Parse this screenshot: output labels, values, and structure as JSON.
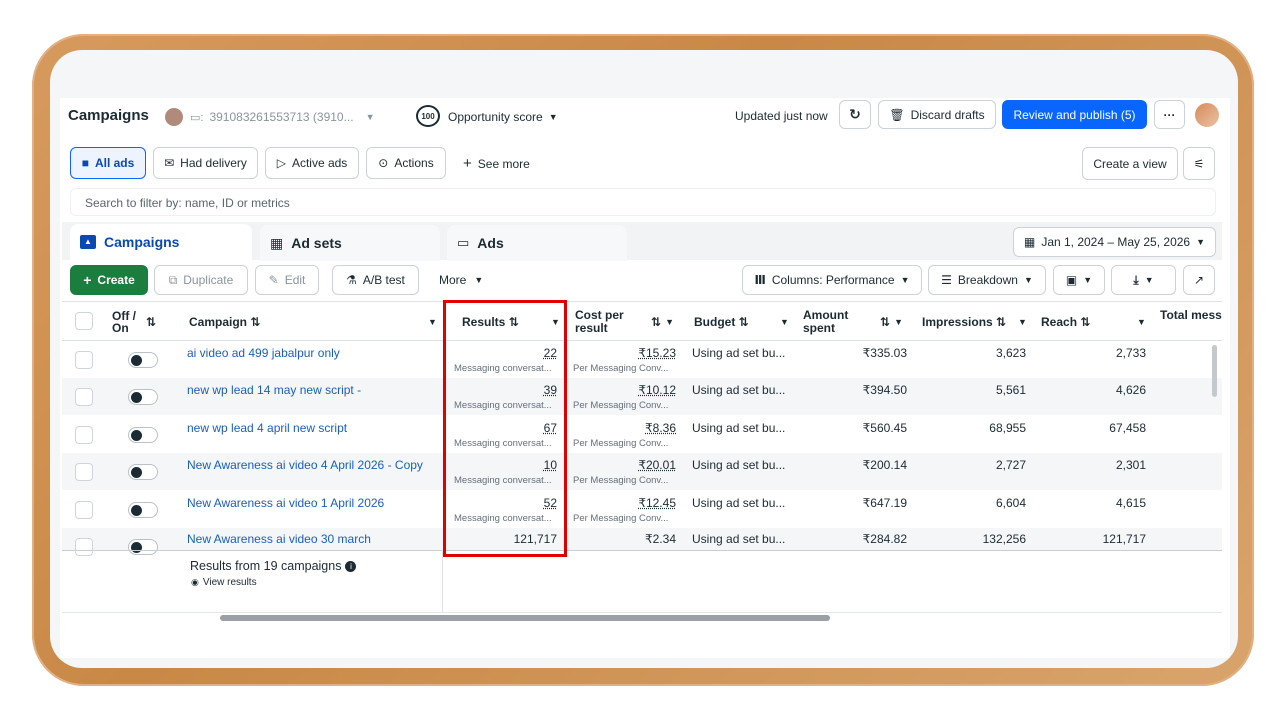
{
  "header": {
    "title": "Campaigns",
    "account_id": "391083261553713 (3910...",
    "opportunity_score_value": "100",
    "opportunity_label": "Opportunity score",
    "updated_text": "Updated just now",
    "discard_label": "Discard drafts",
    "review_label": "Review and publish (5)",
    "more_dots": "···"
  },
  "filters": {
    "all_ads": "All ads",
    "had_delivery": "Had delivery",
    "active_ads": "Active ads",
    "actions": "Actions",
    "see_more": "See more",
    "create_view": "Create a view"
  },
  "search": {
    "placeholder": "Search to filter by: name, ID or metrics"
  },
  "tabs": [
    {
      "label": "Campaigns"
    },
    {
      "label": "Ad sets"
    },
    {
      "label": "Ads"
    }
  ],
  "date_range": "Jan 1, 2024 – May 25, 2026",
  "toolbar": {
    "create": "Create",
    "duplicate": "Duplicate",
    "edit": "Edit",
    "ab_test": "A/B test",
    "more": "More",
    "columns": "Columns: Performance",
    "breakdown": "Breakdown"
  },
  "columns": {
    "off_on": "Off / On",
    "campaign": "Campaign",
    "results": "Results",
    "cost_per_result": "Cost per result",
    "budget": "Budget",
    "amount_spent": "Amount spent",
    "impressions": "Impressions",
    "reach": "Reach",
    "total_messaging": "Total messaging."
  },
  "rows": [
    {
      "campaign": "ai video ad 499 jabalpur only",
      "results": "22",
      "results_sub": "Messaging conversat...",
      "cost": "₹15.23",
      "cost_sub": "Per Messaging Conv...",
      "budget": "Using ad set bu...",
      "spent": "₹335.03",
      "impressions": "3,623",
      "reach": "2,733"
    },
    {
      "campaign": "new wp lead 14 may new script -",
      "results": "39",
      "results_sub": "Messaging conversat...",
      "cost": "₹10.12",
      "cost_sub": "Per Messaging Conv...",
      "budget": "Using ad set bu...",
      "spent": "₹394.50",
      "impressions": "5,561",
      "reach": "4,626"
    },
    {
      "campaign": "new wp lead 4 april new script",
      "results": "67",
      "results_sub": "Messaging conversat...",
      "cost": "₹8.36",
      "cost_sub": "Per Messaging Conv...",
      "budget": "Using ad set bu...",
      "spent": "₹560.45",
      "impressions": "68,955",
      "reach": "67,458"
    },
    {
      "campaign": "New Awareness ai video 4 April 2026 - Copy",
      "results": "10",
      "results_sub": "Messaging conversat...",
      "cost": "₹20.01",
      "cost_sub": "Per Messaging Conv...",
      "budget": "Using ad set bu...",
      "spent": "₹200.14",
      "impressions": "2,727",
      "reach": "2,301"
    },
    {
      "campaign": "New Awareness ai video 1 April 2026",
      "results": "52",
      "results_sub": "Messaging conversat...",
      "cost": "₹12.45",
      "cost_sub": "Per Messaging Conv...",
      "budget": "Using ad set bu...",
      "spent": "₹647.19",
      "impressions": "6,604",
      "reach": "4,615"
    },
    {
      "campaign": "New Awareness ai video 30 march",
      "results": "121,717",
      "results_sub": "",
      "cost": "₹2.34",
      "cost_sub": "",
      "budget": "Using ad set bu...",
      "spent": "₹284.82",
      "impressions": "132,256",
      "reach": "121,717"
    }
  ],
  "footer": {
    "summary": "Results from 19 campaigns",
    "view_results": "View results"
  },
  "colors": {
    "primary": "#0866ff",
    "create_green": "#1b7e3e",
    "highlight_red": "#e00000",
    "link": "#1a5fbf"
  }
}
